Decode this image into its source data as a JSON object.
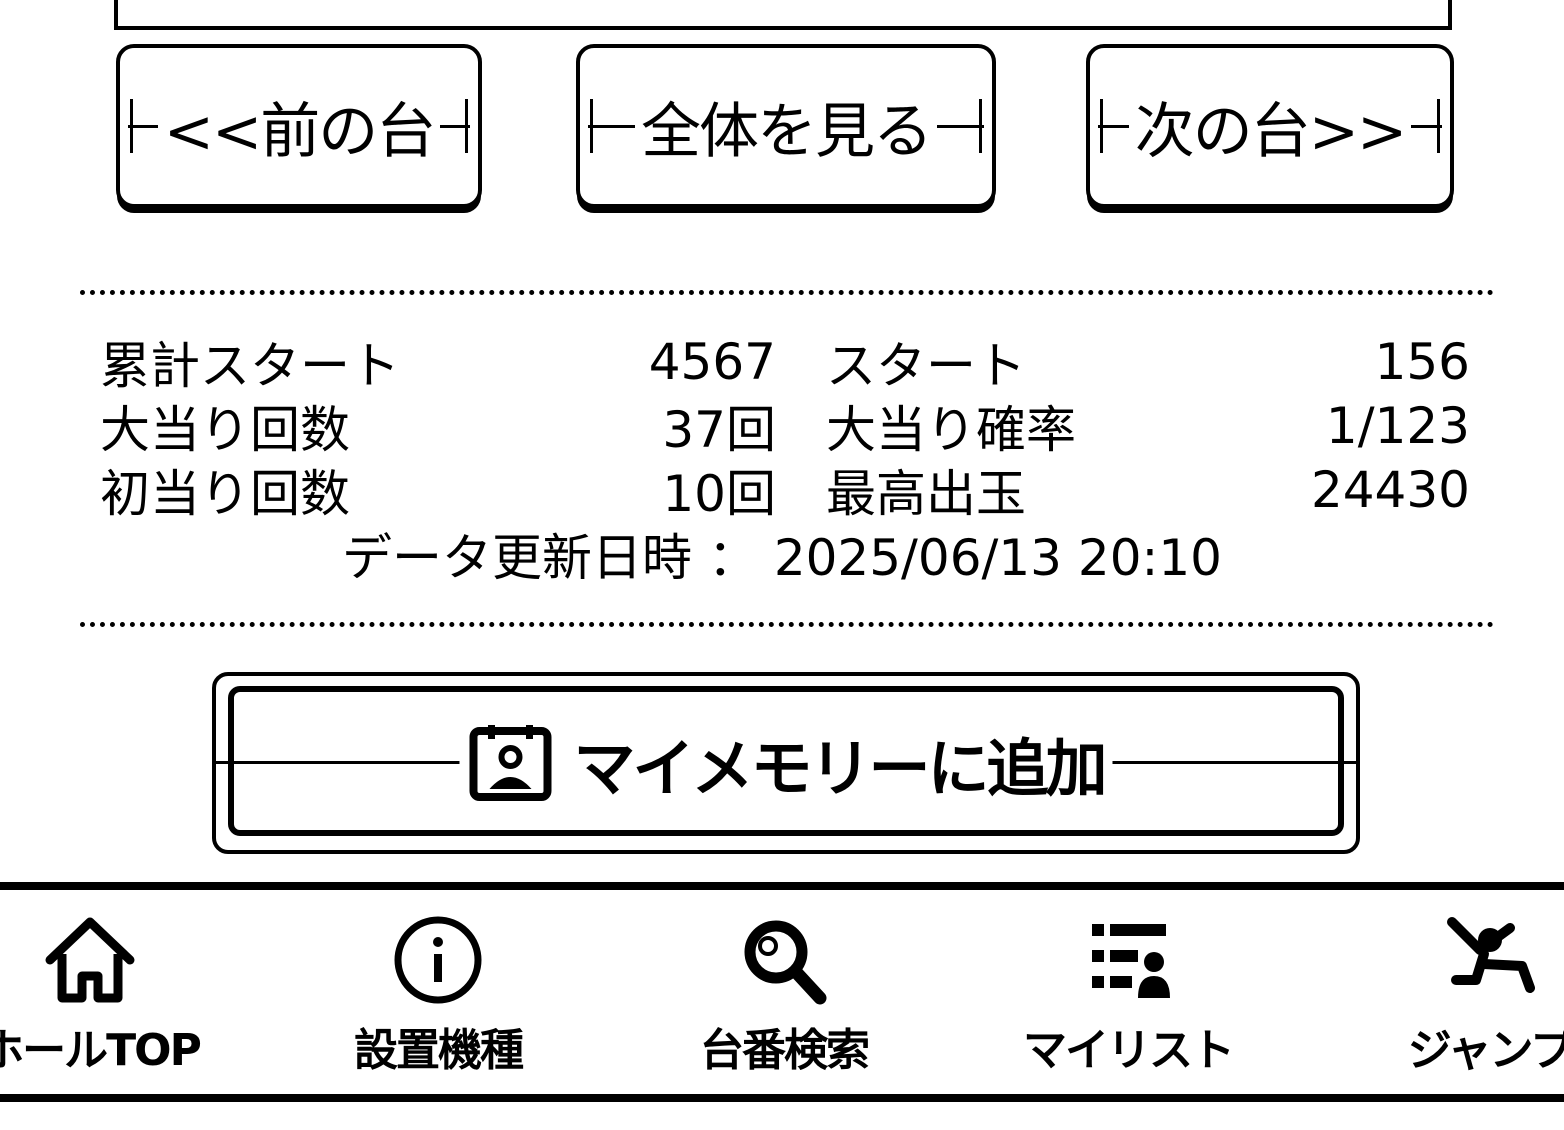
{
  "nav": {
    "prev_label": "<<前の台",
    "all_label": "全体を見る",
    "next_label": "次の台>>"
  },
  "stats": {
    "rows": [
      {
        "left_label": "累計スタート",
        "left_value": "4567",
        "right_label": "スタート",
        "right_value": "156"
      },
      {
        "left_label": "大当り回数",
        "left_value": "37回",
        "right_label": "大当り確率",
        "right_value": "1/123"
      },
      {
        "left_label": "初当り回数",
        "left_value": "10回",
        "right_label": "最高出玉",
        "right_value": "24430"
      }
    ],
    "update_label": "データ更新日時",
    "update_separator": "：",
    "update_value": "2025/06/13 20:10"
  },
  "memory_button": {
    "label": "マイメモリーに追加",
    "icon": "memory-add-icon"
  },
  "tabbar": {
    "items": [
      {
        "label": "ホールTOP",
        "icon": "home-icon"
      },
      {
        "label": "設置機種",
        "icon": "info-icon"
      },
      {
        "label": "台番検索",
        "icon": "search-icon"
      },
      {
        "label": "マイリスト",
        "icon": "list-icon"
      },
      {
        "label": "ジャンプ",
        "icon": "jump-icon"
      }
    ]
  }
}
